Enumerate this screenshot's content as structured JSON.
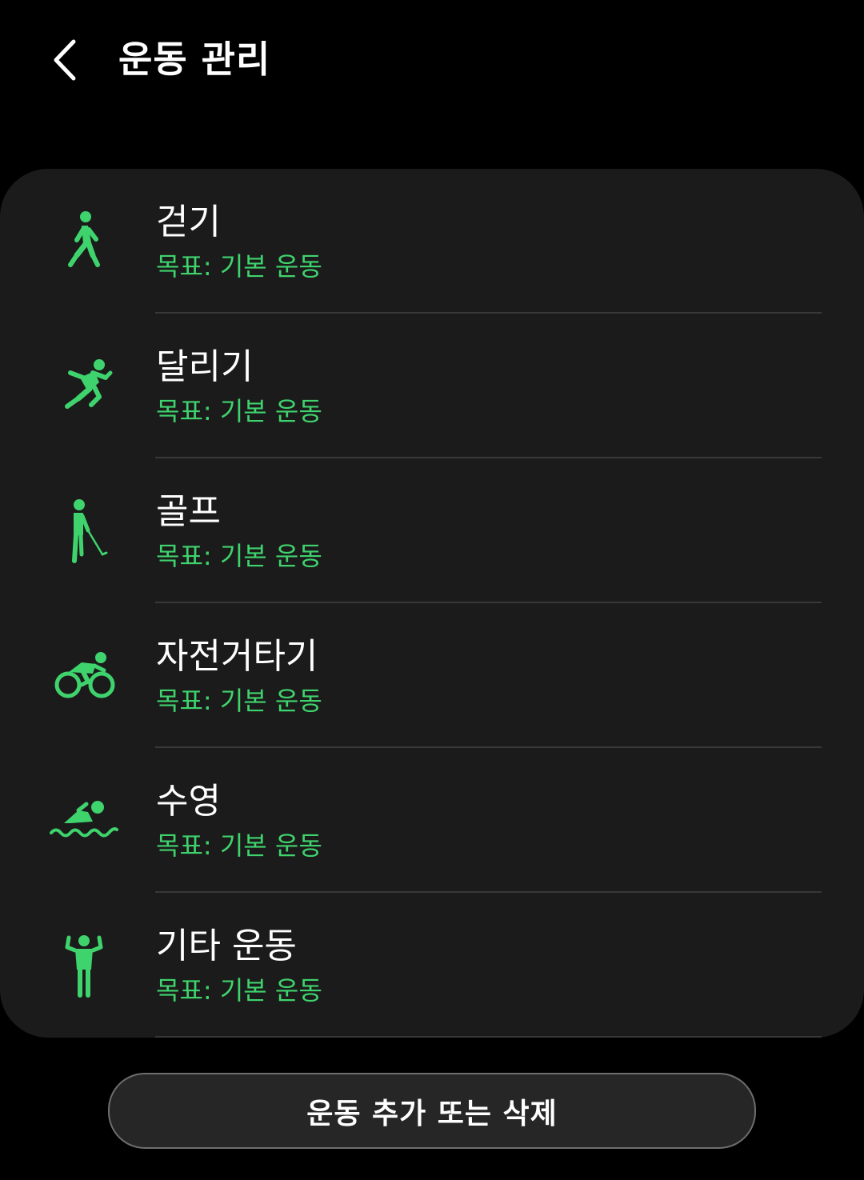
{
  "header": {
    "back_icon": "chevron-left-icon",
    "title": "운동 관리"
  },
  "colors": {
    "background": "#000000",
    "card": "#1b1b1b",
    "accent": "#3fd36d",
    "divider": "#383838"
  },
  "exercises": [
    {
      "name": "걷기",
      "goal": "목표: 기본 운동",
      "icon": "walking-icon"
    },
    {
      "name": "달리기",
      "goal": "목표: 기본 운동",
      "icon": "running-icon"
    },
    {
      "name": "골프",
      "goal": "목표: 기본 운동",
      "icon": "golf-icon"
    },
    {
      "name": "자전거타기",
      "goal": "목표: 기본 운동",
      "icon": "cycling-icon"
    },
    {
      "name": "수영",
      "goal": "목표: 기본 운동",
      "icon": "swimming-icon"
    },
    {
      "name": "기타 운동",
      "goal": "목표: 기본 운동",
      "icon": "other-exercise-icon"
    }
  ],
  "footer": {
    "button_label": "운동 추가 또는 삭제"
  }
}
